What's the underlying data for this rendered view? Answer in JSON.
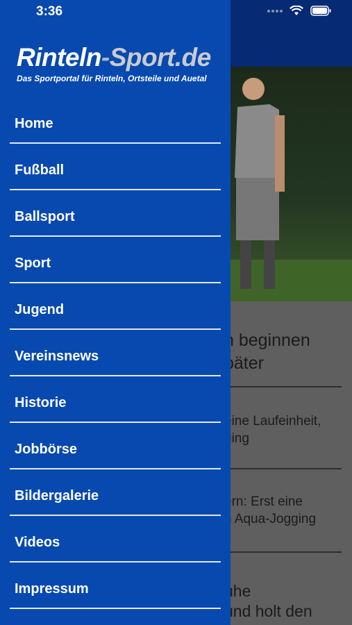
{
  "status_bar": {
    "time": "3:36"
  },
  "drawer": {
    "logo": {
      "part1": "Rinteln",
      "dash": "-",
      "part2": "Sport.de",
      "tagline": "Das Sportportal für Rinteln, Ortsteile und Auetal"
    },
    "menu": [
      {
        "label": "Home"
      },
      {
        "label": "Fußball"
      },
      {
        "label": "Ballsport"
      },
      {
        "label": "Sport"
      },
      {
        "label": "Jugend"
      },
      {
        "label": "Vereinsnews"
      },
      {
        "label": "Historie"
      },
      {
        "label": "Jobbörse"
      },
      {
        "label": "Bildergalerie"
      },
      {
        "label": "Videos"
      },
      {
        "label": "Impressum"
      }
    ]
  },
  "background": {
    "article_title": "n beginnen\npäter",
    "teaser1": "eine Laufeinheit,\nging",
    "teaser2": "ern: Erst eine\nn Aqua-Jogging",
    "teaser3": "uhe\nund holt den"
  },
  "colors": {
    "drawer": "#0849b0",
    "header": "#062a73"
  }
}
